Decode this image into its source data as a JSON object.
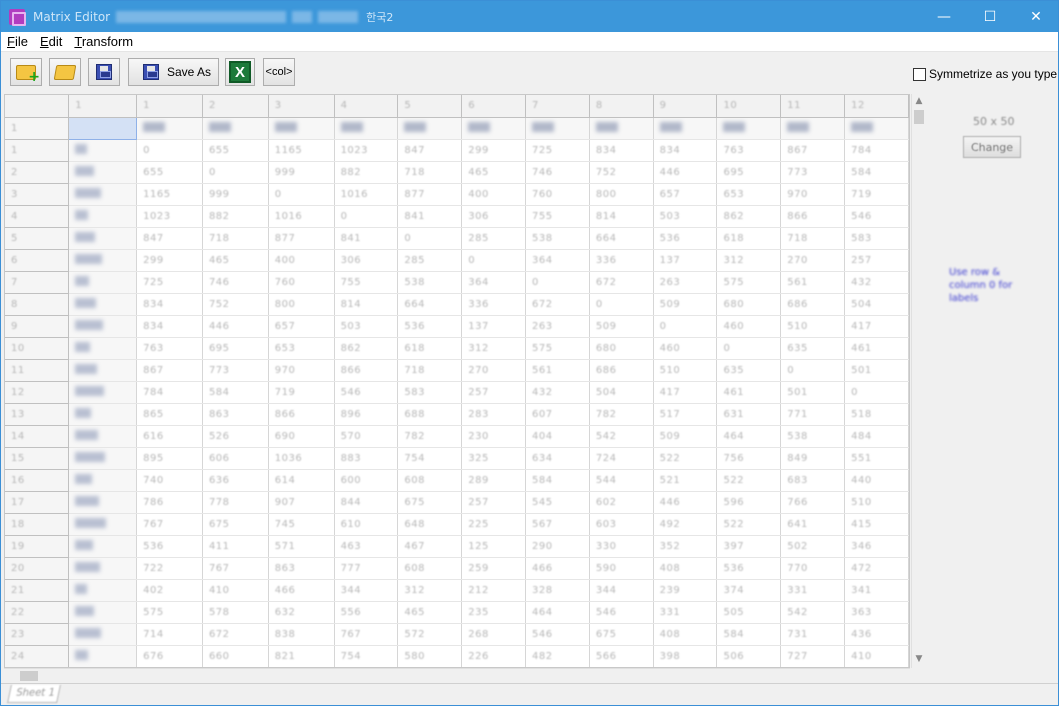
{
  "window": {
    "title": "Matrix Editor",
    "title_suffix": "한국2",
    "min_label": "—",
    "max_label": "☐",
    "close_label": "✕"
  },
  "menu": [
    {
      "key": "F",
      "rest": "ile"
    },
    {
      "key": "E",
      "rest": "dit"
    },
    {
      "key": "T",
      "rest": "ransform"
    }
  ],
  "toolbar": {
    "save_as_label": "Save As",
    "excel_label": "X",
    "col_label": "<col>",
    "symmetrize_label": "Symmetrize as you type",
    "symmetrize_checked": false
  },
  "grid": {
    "column_headers": [
      "1",
      "1",
      "2",
      "3",
      "4",
      "5",
      "6",
      "7",
      "8",
      "9",
      "10",
      "11",
      "12"
    ],
    "row_headers": [
      "1",
      "1",
      "2",
      "3",
      "4",
      "5",
      "6",
      "7",
      "8",
      "9",
      "10",
      "11",
      "12",
      "13",
      "14",
      "15",
      "16",
      "17",
      "18",
      "19",
      "20",
      "21",
      "22",
      "23",
      "24"
    ],
    "rows": [
      [
        "0",
        "655",
        "1165",
        "1023",
        "847",
        "299",
        "725",
        "834",
        "834",
        "763",
        "867",
        "784"
      ],
      [
        "655",
        "0",
        "999",
        "882",
        "718",
        "465",
        "746",
        "752",
        "446",
        "695",
        "773",
        "584"
      ],
      [
        "1165",
        "999",
        "0",
        "1016",
        "877",
        "400",
        "760",
        "800",
        "657",
        "653",
        "970",
        "719"
      ],
      [
        "1023",
        "882",
        "1016",
        "0",
        "841",
        "306",
        "755",
        "814",
        "503",
        "862",
        "866",
        "546"
      ],
      [
        "847",
        "718",
        "877",
        "841",
        "0",
        "285",
        "538",
        "664",
        "536",
        "618",
        "718",
        "583"
      ],
      [
        "299",
        "465",
        "400",
        "306",
        "285",
        "0",
        "364",
        "336",
        "137",
        "312",
        "270",
        "257"
      ],
      [
        "725",
        "746",
        "760",
        "755",
        "538",
        "364",
        "0",
        "672",
        "263",
        "575",
        "561",
        "432"
      ],
      [
        "834",
        "752",
        "800",
        "814",
        "664",
        "336",
        "672",
        "0",
        "509",
        "680",
        "686",
        "504"
      ],
      [
        "834",
        "446",
        "657",
        "503",
        "536",
        "137",
        "263",
        "509",
        "0",
        "460",
        "510",
        "417"
      ],
      [
        "763",
        "695",
        "653",
        "862",
        "618",
        "312",
        "575",
        "680",
        "460",
        "0",
        "635",
        "461"
      ],
      [
        "867",
        "773",
        "970",
        "866",
        "718",
        "270",
        "561",
        "686",
        "510",
        "635",
        "0",
        "501"
      ],
      [
        "784",
        "584",
        "719",
        "546",
        "583",
        "257",
        "432",
        "504",
        "417",
        "461",
        "501",
        "0"
      ],
      [
        "865",
        "863",
        "866",
        "896",
        "688",
        "283",
        "607",
        "782",
        "517",
        "631",
        "771",
        "518"
      ],
      [
        "616",
        "526",
        "690",
        "570",
        "782",
        "230",
        "404",
        "542",
        "509",
        "464",
        "538",
        "484"
      ],
      [
        "895",
        "606",
        "1036",
        "883",
        "754",
        "325",
        "634",
        "724",
        "522",
        "756",
        "849",
        "551"
      ],
      [
        "740",
        "636",
        "614",
        "600",
        "608",
        "289",
        "584",
        "544",
        "521",
        "522",
        "683",
        "440"
      ],
      [
        "786",
        "778",
        "907",
        "844",
        "675",
        "257",
        "545",
        "602",
        "446",
        "596",
        "766",
        "510"
      ],
      [
        "767",
        "675",
        "745",
        "610",
        "648",
        "225",
        "567",
        "603",
        "492",
        "522",
        "641",
        "415"
      ],
      [
        "536",
        "411",
        "571",
        "463",
        "467",
        "125",
        "290",
        "330",
        "352",
        "397",
        "502",
        "346"
      ],
      [
        "722",
        "767",
        "863",
        "777",
        "608",
        "259",
        "466",
        "590",
        "408",
        "536",
        "770",
        "472"
      ],
      [
        "402",
        "410",
        "466",
        "344",
        "312",
        "212",
        "328",
        "344",
        "239",
        "374",
        "331",
        "341"
      ],
      [
        "575",
        "578",
        "632",
        "556",
        "465",
        "235",
        "464",
        "546",
        "331",
        "505",
        "542",
        "363"
      ],
      [
        "714",
        "672",
        "838",
        "767",
        "572",
        "268",
        "546",
        "675",
        "408",
        "584",
        "731",
        "436"
      ],
      [
        "676",
        "660",
        "821",
        "754",
        "580",
        "226",
        "482",
        "566",
        "398",
        "506",
        "727",
        "410"
      ]
    ]
  },
  "side_panel": {
    "size_text": "50 x 50",
    "change_label": "Change",
    "hint": "Use row & column 0 for labels"
  },
  "sheet_tab": "Sheet 1"
}
